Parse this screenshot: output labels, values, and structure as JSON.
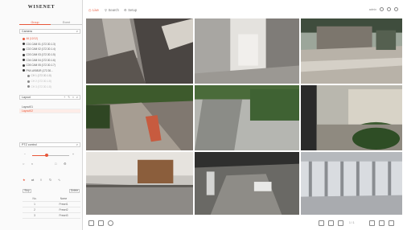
{
  "app": {
    "logo": "WISENET"
  },
  "sidebar": {
    "tabs": [
      {
        "label": "Group"
      },
      {
        "label": "Event"
      }
    ],
    "camera_panel": {
      "title": "Camera"
    },
    "tree": [
      {
        "label": "All (12/12)"
      },
      {
        "label": "C01 CAM 01 (172.30.1.3)"
      },
      {
        "label": "C02 CAM 02 (172.30.1.4)"
      },
      {
        "label": "C03 CAM 03 (172.30.1.5)"
      },
      {
        "label": "C04 CAM 04 (172.30.1.6)"
      },
      {
        "label": "C05 CAM 05 (172.30.1.7)"
      },
      {
        "label": "PNV-A9081R (172.30..."
      },
      {
        "label": "CH 1 (172.30.1.8)"
      },
      {
        "label": "CH 2 (172.30.1.8)"
      },
      {
        "label": "CH 3 (172.30.1.8)"
      }
    ],
    "layout_panel": {
      "title": "Layout"
    },
    "layouts": [
      {
        "label": "Layout01"
      },
      {
        "label": "Layout02"
      }
    ],
    "ptz_panel": {
      "title": "PTZ control"
    },
    "ptz": {
      "zoom_level": 0.4,
      "buttons": {
        "stop": "Stop",
        "delete": "Delete"
      }
    },
    "presets": {
      "headers": [
        "No.",
        "Name"
      ],
      "rows": [
        [
          "1",
          "Preset1"
        ],
        [
          "2",
          "Preset2"
        ],
        [
          "3",
          "Preset3"
        ]
      ]
    }
  },
  "topbar": {
    "menu": [
      {
        "label": "Live"
      },
      {
        "label": "Search"
      },
      {
        "label": "Setup"
      }
    ],
    "user": "admin"
  },
  "bottombar": {
    "page_info": "1 / 1"
  }
}
